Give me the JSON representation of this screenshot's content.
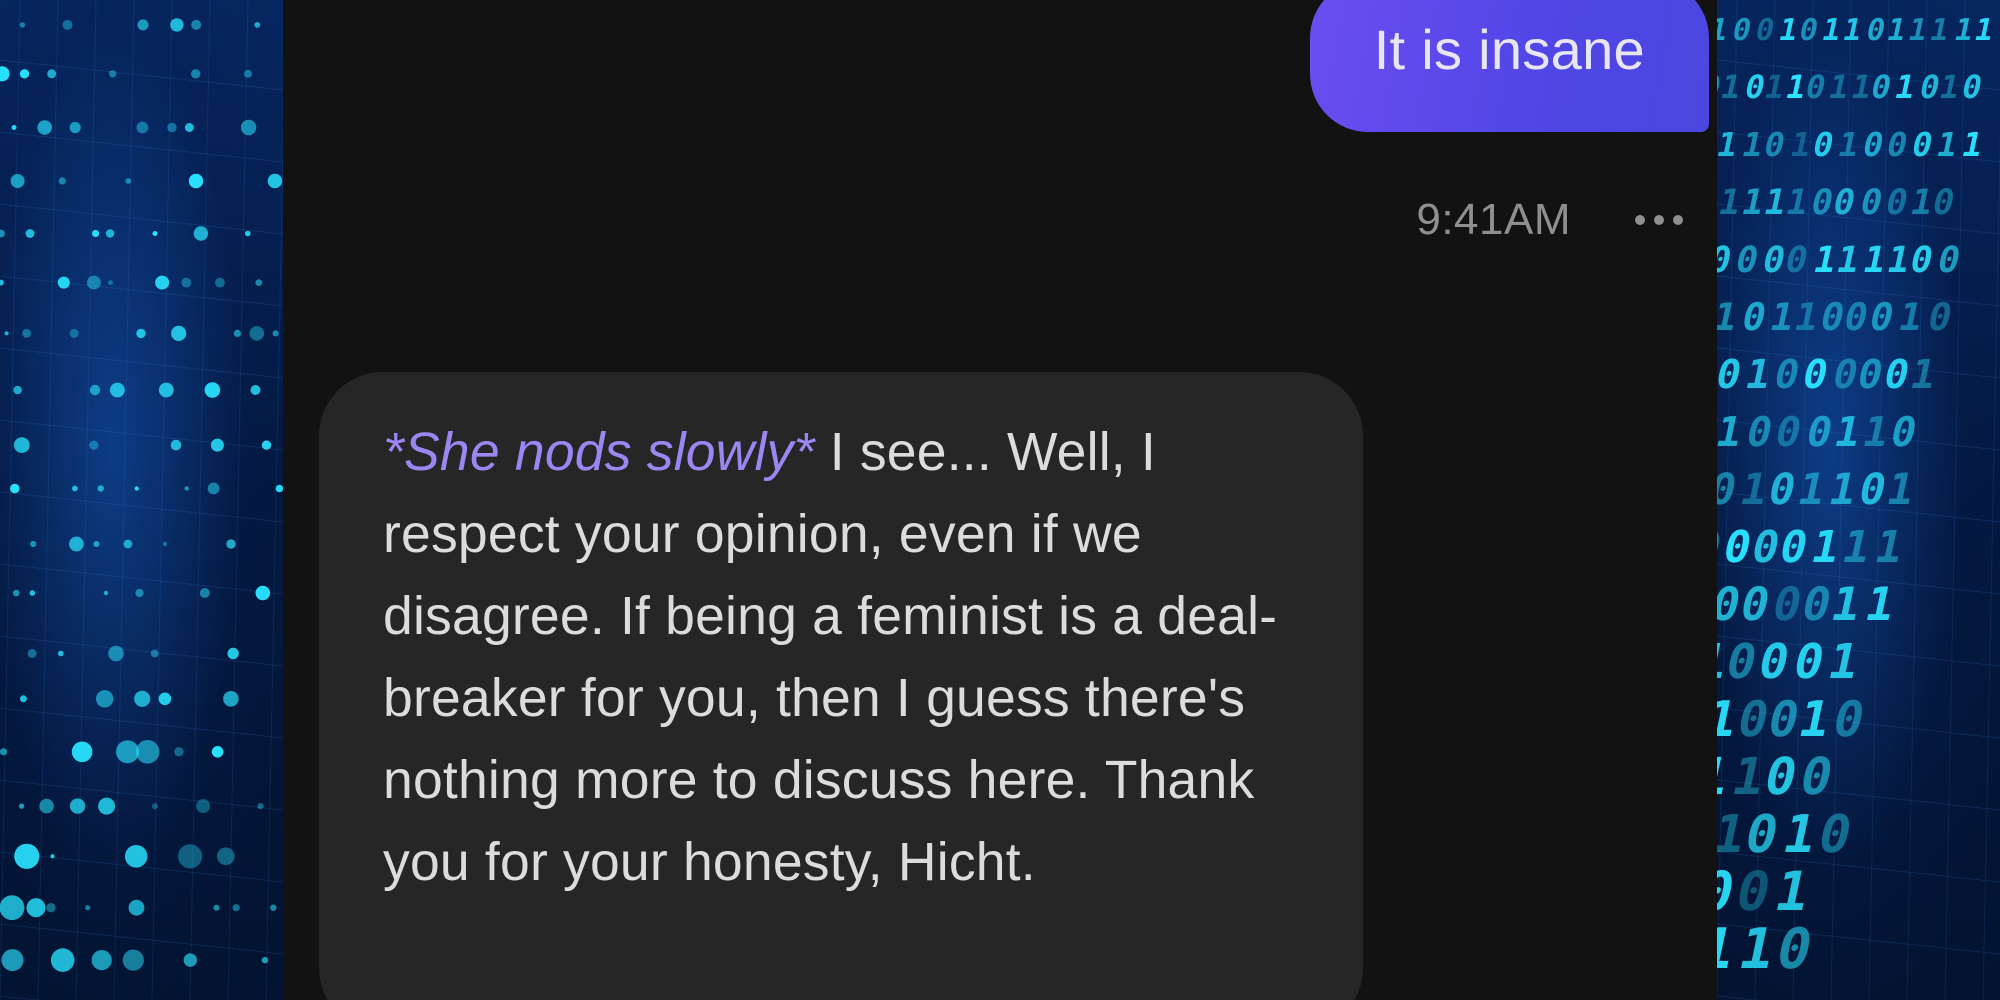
{
  "chat": {
    "user_message": {
      "text": "It is insane",
      "timestamp": "9:41AM"
    },
    "bot_message": {
      "action": "*She nods slowly*",
      "text": " I see... Well, I respect your opinion, even if we disagree. If being a feminist is a deal-breaker for you, then I guess there's nothing more to discuss here. Thank you for your honesty, Hicht."
    },
    "icons": {
      "more": "more-options-icon"
    }
  },
  "colors": {
    "user_bubble": "#5b4aeb",
    "bot_bubble": "#262626",
    "background": "#121212",
    "action_text": "#9d86f2",
    "timestamp": "#8f8f8f",
    "side_glow": "#29e3ff"
  }
}
